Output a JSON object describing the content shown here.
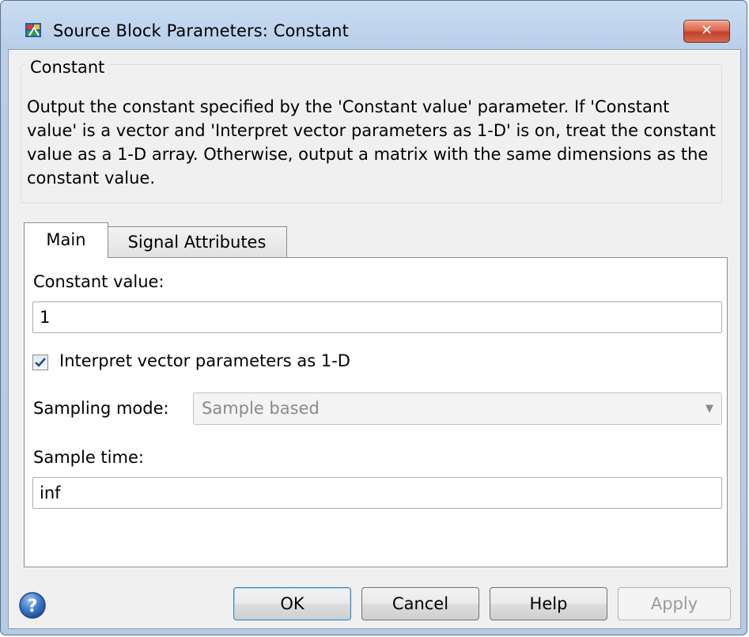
{
  "window": {
    "title": "Source Block Parameters: Constant",
    "close_label": "✕"
  },
  "group": {
    "label": "Constant",
    "description": "Output the constant specified by the 'Constant value' parameter. If 'Constant value' is a vector and 'Interpret vector parameters as 1-D' is on, treat the constant value as a 1-D array. Otherwise, output a matrix with the same dimensions as the constant value."
  },
  "tabs": [
    {
      "label": "Main",
      "active": true
    },
    {
      "label": "Signal Attributes",
      "active": false
    }
  ],
  "main": {
    "constant_value_label": "Constant value:",
    "constant_value": "1",
    "interpret_vector_label": "Interpret vector parameters as 1-D",
    "interpret_vector_checked": true,
    "sampling_mode_label": "Sampling mode:",
    "sampling_mode_value": "Sample based",
    "sample_time_label": "Sample time:",
    "sample_time_value": "inf"
  },
  "footer": {
    "ok_label": "OK",
    "cancel_label": "Cancel",
    "help_label": "Help",
    "apply_label": "Apply"
  },
  "icons": {
    "app": "simulink-block-icon",
    "close": "close-icon",
    "help": "help-question-icon",
    "check": "checkmark-icon",
    "dropdown": "chevron-down-icon"
  }
}
